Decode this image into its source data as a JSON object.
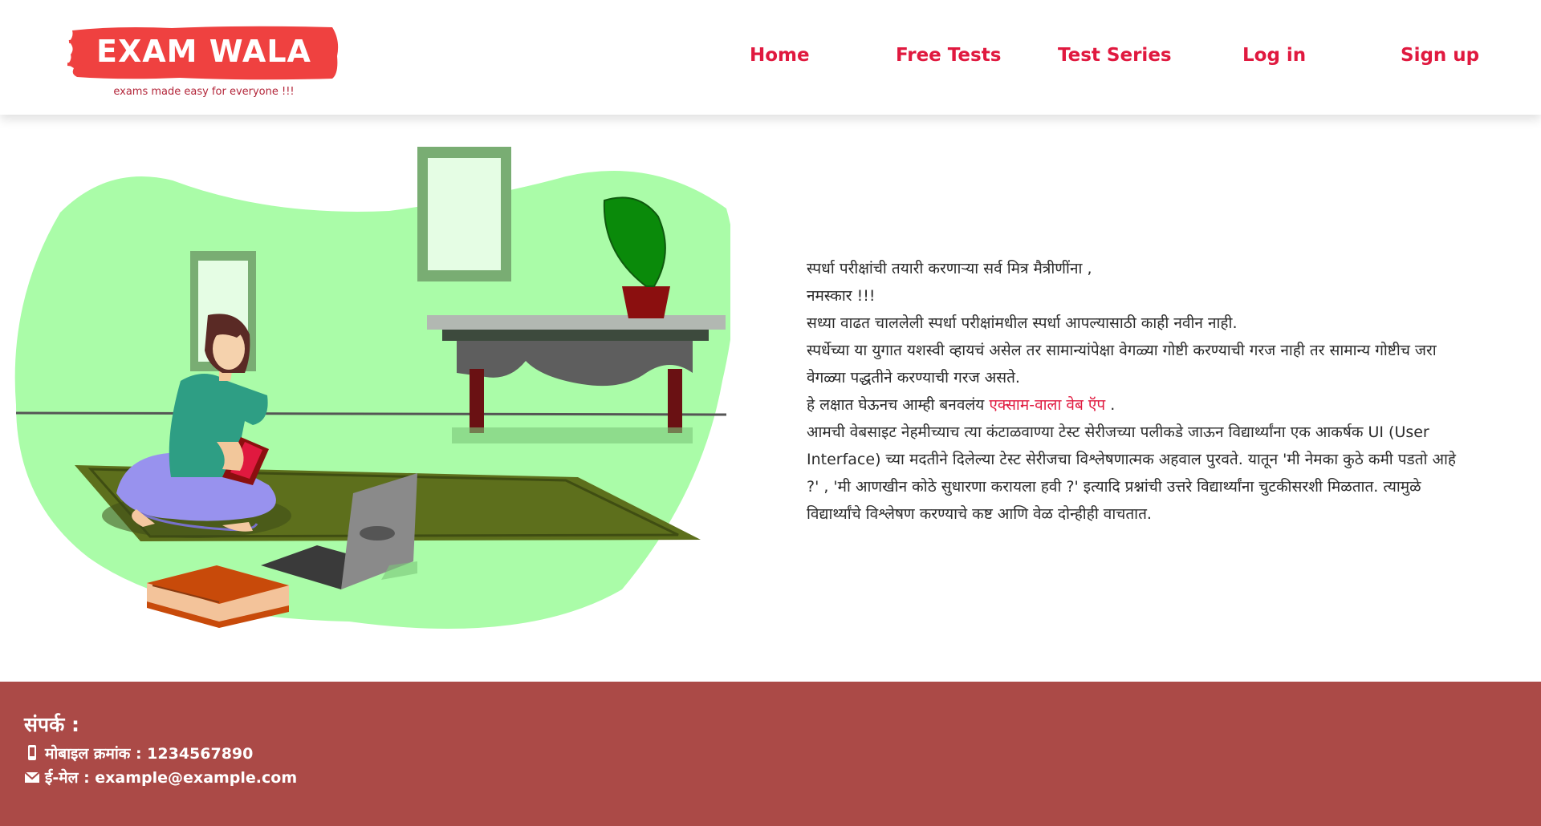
{
  "brand": {
    "name": "EXAM WALA",
    "tagline": "exams made easy for everyone !!!",
    "color": "#ef4140"
  },
  "nav": {
    "items": [
      {
        "label": "Home"
      },
      {
        "label": "Free Tests"
      },
      {
        "label": "Test Series"
      },
      {
        "label": "Log in"
      },
      {
        "label": "Sign up"
      }
    ],
    "color": "#e0193f"
  },
  "article": {
    "greeting": "स्पर्धा परीक्षांची तयारी करणाऱ्या सर्व मित्र मैत्रीणींना ,",
    "salutation": "नमस्कार !!!",
    "line1": "सध्या वाढत चाललेली स्पर्धा परीक्षांमधील स्पर्धा आपल्यासाठी काही नवीन नाही.",
    "line2": "स्पर्धेच्या या युगात यशस्वी व्हायचं असेल तर सामान्यांपेक्षा वेगळ्या गोष्टी करण्याची गरज नाही तर सामान्य गोष्टीच जरा वेगळ्या पद्धतीने करण्याची गरज असते.",
    "line3_prefix": "हे लक्षात घेऊनच आम्ही बनवलंय",
    "line3_highlight": "एक्साम-वाला वेब ऍप",
    "line3_suffix": ".",
    "line4": "आमची वेबसाइट नेहमीच्याच त्या कंटाळवाण्या टेस्ट सेरीजच्या पलीकडे जाऊन विद्यार्थ्यांना एक आकर्षक UI (User Interface) च्या मदतीने दिलेल्या टेस्ट सेरीजचा विश्लेषणात्मक अहवाल पुरवते. यातून 'मी नेमका कुठे कमी पडतो आहे ?' , 'मी आणखीन कोठे सुधारणा करायला हवी ?' इत्यादि प्रश्नांची उत्तरे विद्यार्थ्यांना चुटकीसरशी मिळतात. त्यामुळे विद्यार्थ्यांचे विश्लेषण करण्याचे कष्ट आणि वेळ दोन्हीही वाचतात."
  },
  "footer": {
    "title": "संपर्क :",
    "mobile": "मोबाइल क्रमांक : 1234567890",
    "email": "ई-मेल : example@example.com",
    "mobile_icon": "phone-icon",
    "email_icon": "mail-icon",
    "background": "#ab4a47"
  }
}
